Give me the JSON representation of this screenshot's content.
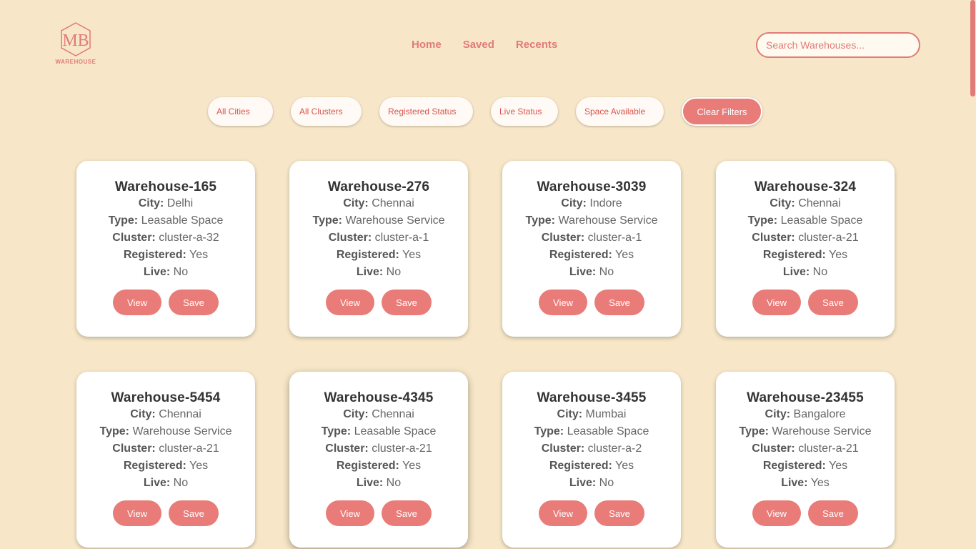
{
  "logo": {
    "monogram": "MB",
    "text": "WAREHOUSE"
  },
  "nav": {
    "items": [
      "Home",
      "Saved",
      "Recents"
    ]
  },
  "search": {
    "placeholder": "Search Warehouses..."
  },
  "filters": {
    "items": [
      "All Cities",
      "All Clusters",
      "Registered Status",
      "Live Status",
      "Space Available"
    ],
    "clear_label": "Clear Filters"
  },
  "labels": {
    "city": "City:",
    "type": "Type:",
    "cluster": "Cluster:",
    "registered": "Registered:",
    "live": "Live:"
  },
  "buttons": {
    "view": "View",
    "save": "Save"
  },
  "warehouses": [
    {
      "name": "Warehouse-165",
      "city": "Delhi",
      "type": "Leasable Space",
      "cluster": "cluster-a-32",
      "registered": "Yes",
      "live": "No"
    },
    {
      "name": "Warehouse-276",
      "city": "Chennai",
      "type": "Warehouse Service",
      "cluster": "cluster-a-1",
      "registered": "Yes",
      "live": "No"
    },
    {
      "name": "Warehouse-3039",
      "city": "Indore",
      "type": "Warehouse Service",
      "cluster": "cluster-a-1",
      "registered": "Yes",
      "live": "No"
    },
    {
      "name": "Warehouse-324",
      "city": "Chennai",
      "type": "Leasable Space",
      "cluster": "cluster-a-21",
      "registered": "Yes",
      "live": "No"
    },
    {
      "name": "Warehouse-5454",
      "city": "Chennai",
      "type": "Warehouse Service",
      "cluster": "cluster-a-21",
      "registered": "Yes",
      "live": "No"
    },
    {
      "name": "Warehouse-4345",
      "city": "Chennai",
      "type": "Leasable Space",
      "cluster": "cluster-a-21",
      "registered": "Yes",
      "live": "No"
    },
    {
      "name": "Warehouse-3455",
      "city": "Mumbai",
      "type": "Leasable Space",
      "cluster": "cluster-a-2",
      "registered": "Yes",
      "live": "No"
    },
    {
      "name": "Warehouse-23455",
      "city": "Bangalore",
      "type": "Warehouse Service",
      "cluster": "cluster-a-21",
      "registered": "Yes",
      "live": "Yes"
    }
  ]
}
